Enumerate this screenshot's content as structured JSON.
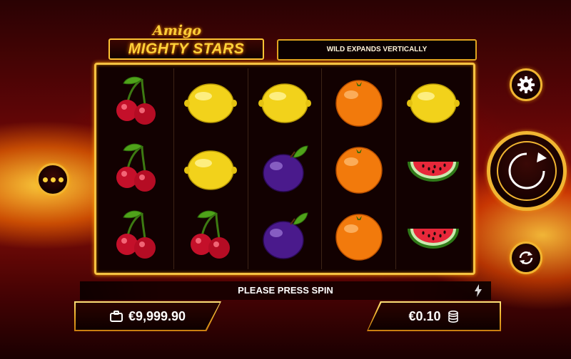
{
  "game": {
    "title_top": "Amigo",
    "title_main": "MIGHTY STARS",
    "banner": "WILD EXPANDS VERTICALLY",
    "status": "PLEASE PRESS SPIN"
  },
  "reels": [
    [
      "cherry",
      "cherry",
      "cherry"
    ],
    [
      "lemon",
      "lemon",
      "cherry"
    ],
    [
      "lemon",
      "plum",
      "plum"
    ],
    [
      "orange",
      "orange",
      "orange"
    ],
    [
      "lemon",
      "watermelon",
      "watermelon"
    ]
  ],
  "footer": {
    "balance": "€9,999.90",
    "bet": "€0.10"
  },
  "icons": {
    "menu": "more-dots-icon",
    "settings": "gear-icon",
    "spin": "spin-arrow-icon",
    "autoplay": "autoplay-icon",
    "turbo": "lightning-icon",
    "wallet": "briefcase-icon",
    "coins": "coin-stack-icon"
  },
  "colors": {
    "gold": "#f1b532",
    "frame_bg": "#120101",
    "background": "#8c0f08"
  }
}
